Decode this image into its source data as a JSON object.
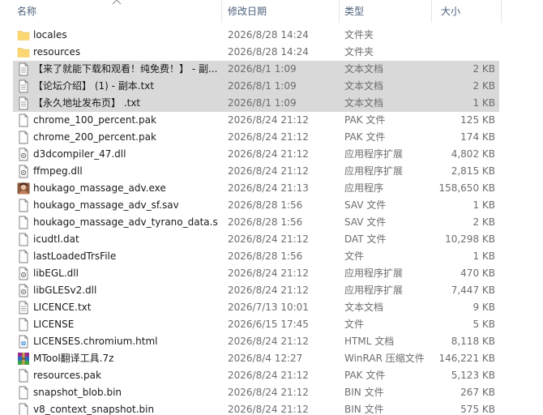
{
  "columns": {
    "name": "名称",
    "date": "修改日期",
    "type": "类型",
    "size": "大小"
  },
  "rows": [
    {
      "name": "locales",
      "date": "2026/8/28 14:24",
      "type": "文件夹",
      "size": "",
      "icon": "folder-icon",
      "selected": false
    },
    {
      "name": "resources",
      "date": "2026/8/28 14:24",
      "type": "文件夹",
      "size": "",
      "icon": "folder-icon",
      "selected": false
    },
    {
      "name": "【来了就能下载和观看！纯免费！】 - 副...",
      "date": "2026/8/1 1:09",
      "type": "文本文档",
      "size": "2 KB",
      "icon": "text-file-icon",
      "selected": true
    },
    {
      "name": "【论坛介绍】 (1) - 副本.txt",
      "date": "2026/8/1 1:09",
      "type": "文本文档",
      "size": "2 KB",
      "icon": "text-file-icon",
      "selected": true
    },
    {
      "name": "【永久地址发布页】 .txt",
      "date": "2026/8/1 1:09",
      "type": "文本文档",
      "size": "1 KB",
      "icon": "text-file-icon",
      "selected": true
    },
    {
      "name": "chrome_100_percent.pak",
      "date": "2026/8/24 21:12",
      "type": "PAK 文件",
      "size": "125 KB",
      "icon": "file-icon",
      "selected": false
    },
    {
      "name": "chrome_200_percent.pak",
      "date": "2026/8/24 21:12",
      "type": "PAK 文件",
      "size": "174 KB",
      "icon": "file-icon",
      "selected": false
    },
    {
      "name": "d3dcompiler_47.dll",
      "date": "2026/8/24 21:12",
      "type": "应用程序扩展",
      "size": "4,802 KB",
      "icon": "dll-file-icon",
      "selected": false
    },
    {
      "name": "ffmpeg.dll",
      "date": "2026/8/24 21:12",
      "type": "应用程序扩展",
      "size": "2,815 KB",
      "icon": "dll-file-icon",
      "selected": false
    },
    {
      "name": "houkago_massage_adv.exe",
      "date": "2026/8/24 21:13",
      "type": "应用程序",
      "size": "158,650 KB",
      "icon": "app-icon",
      "selected": false
    },
    {
      "name": "houkago_massage_adv_sf.sav",
      "date": "2026/8/28 1:56",
      "type": "SAV 文件",
      "size": "1 KB",
      "icon": "file-icon",
      "selected": false
    },
    {
      "name": "houkago_massage_adv_tyrano_data.s...",
      "date": "2026/8/28 1:56",
      "type": "SAV 文件",
      "size": "2 KB",
      "icon": "file-icon",
      "selected": false
    },
    {
      "name": "icudtl.dat",
      "date": "2026/8/24 21:12",
      "type": "DAT 文件",
      "size": "10,298 KB",
      "icon": "file-icon",
      "selected": false
    },
    {
      "name": "lastLoadedTrsFile",
      "date": "2026/8/28 1:56",
      "type": "文件",
      "size": "1 KB",
      "icon": "file-icon",
      "selected": false
    },
    {
      "name": "libEGL.dll",
      "date": "2026/8/24 21:12",
      "type": "应用程序扩展",
      "size": "470 KB",
      "icon": "dll-file-icon",
      "selected": false
    },
    {
      "name": "libGLESv2.dll",
      "date": "2026/8/24 21:12",
      "type": "应用程序扩展",
      "size": "7,447 KB",
      "icon": "dll-file-icon",
      "selected": false
    },
    {
      "name": "LICENCE.txt",
      "date": "2026/7/13 10:01",
      "type": "文本文档",
      "size": "9 KB",
      "icon": "text-file-icon",
      "selected": false
    },
    {
      "name": "LICENSE",
      "date": "2026/6/15 17:45",
      "type": "文件",
      "size": "5 KB",
      "icon": "file-icon",
      "selected": false
    },
    {
      "name": "LICENSES.chromium.html",
      "date": "2026/8/24 21:12",
      "type": "HTML 文档",
      "size": "8,118 KB",
      "icon": "html-file-icon",
      "selected": false
    },
    {
      "name": "MTool翻译工具.7z",
      "date": "2026/8/4 12:27",
      "type": "WinRAR 压缩文件",
      "size": "146,221 KB",
      "icon": "winrar-archive-icon",
      "selected": false
    },
    {
      "name": "resources.pak",
      "date": "2026/8/24 21:12",
      "type": "PAK 文件",
      "size": "5,123 KB",
      "icon": "file-icon",
      "selected": false
    },
    {
      "name": "snapshot_blob.bin",
      "date": "2026/8/24 21:12",
      "type": "BIN 文件",
      "size": "267 KB",
      "icon": "file-icon",
      "selected": false
    },
    {
      "name": "v8_context_snapshot.bin",
      "date": "2026/8/24 21:12",
      "type": "BIN 文件",
      "size": "575 KB",
      "icon": "file-icon",
      "selected": false
    }
  ],
  "colors": {
    "header_text": "#4c607a",
    "selection": "#d9d9d9",
    "folder": "#f8d775",
    "secondary_text": "#6d6d6d"
  }
}
